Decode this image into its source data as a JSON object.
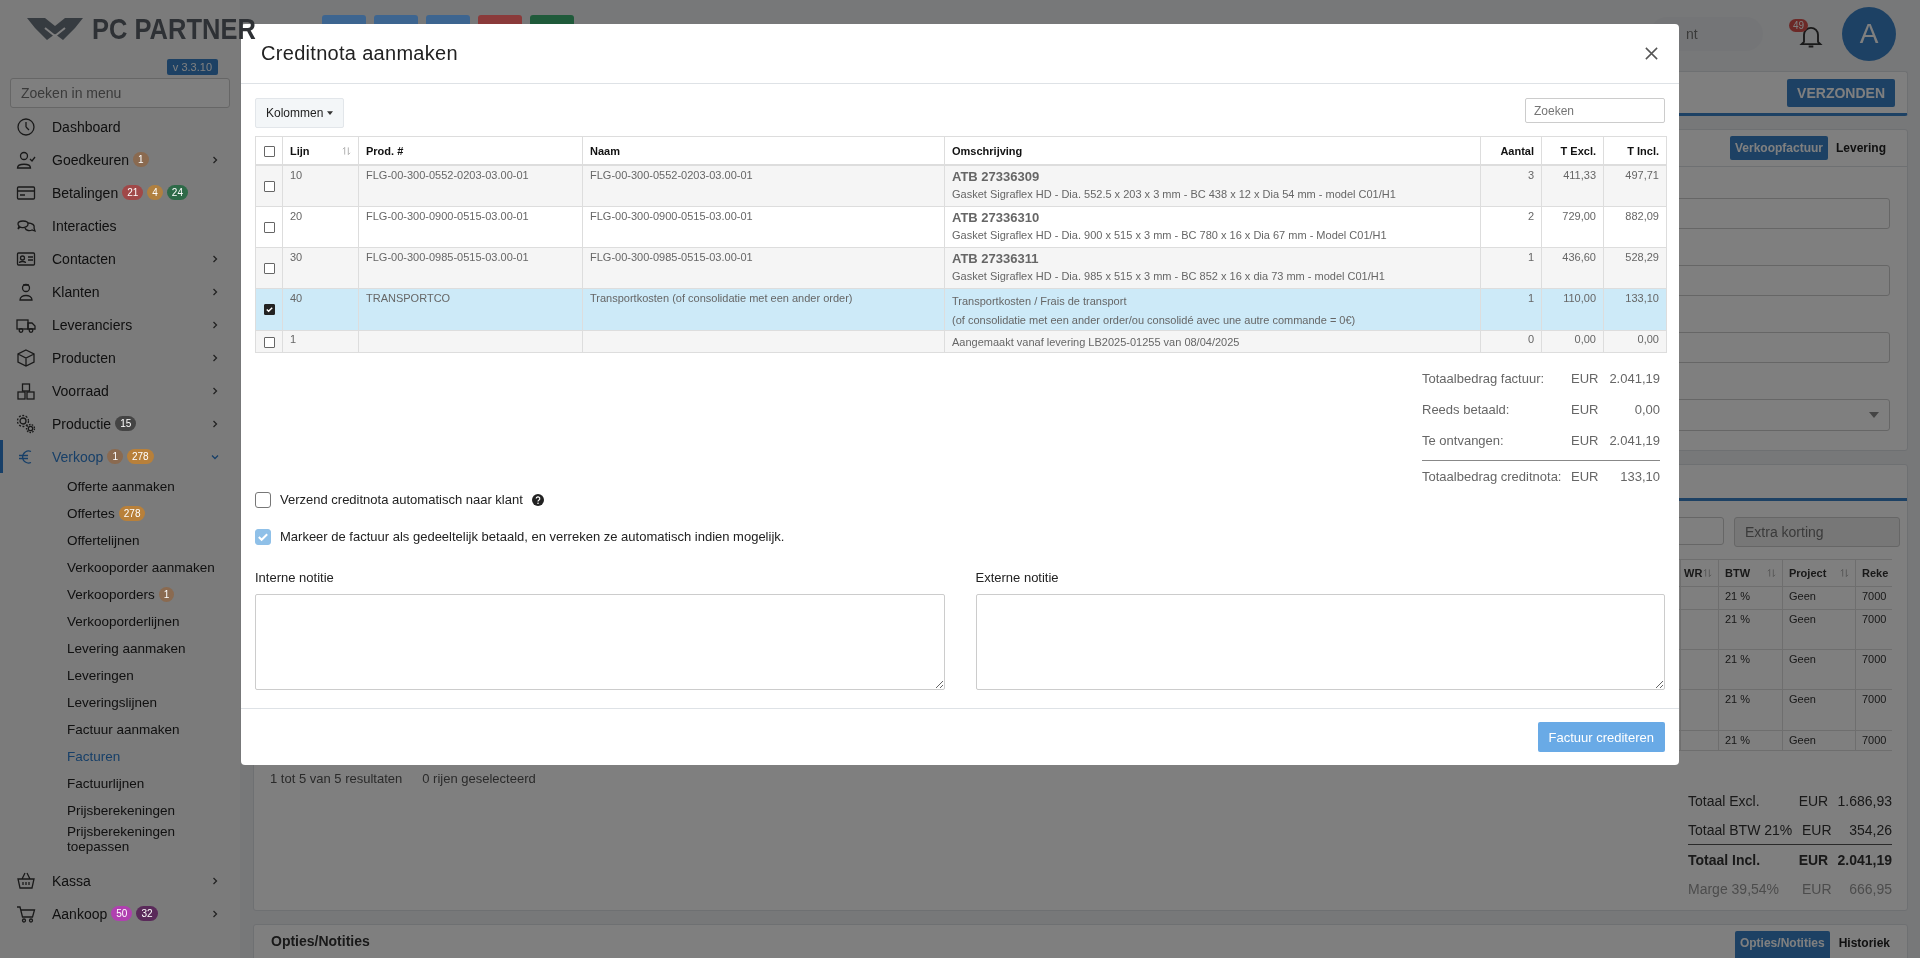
{
  "logo": {
    "text": "PC PARTNER",
    "version": "v 3.3.10"
  },
  "sidebar": {
    "search_placeholder": "Zoeken in menu",
    "items": [
      {
        "label": "Dashboard",
        "selected": false
      },
      {
        "label": "Goedkeuren",
        "selected": false,
        "expanded": false,
        "badges": [
          {
            "text": "1",
            "color": "#8a6a50"
          }
        ]
      },
      {
        "label": "Betalingen",
        "selected": false,
        "badges": [
          {
            "text": "21",
            "color": "#a04848"
          },
          {
            "text": "4",
            "color": "#b08040"
          },
          {
            "text": "24",
            "color": "#2e6a48"
          }
        ]
      },
      {
        "label": "Interacties",
        "selected": false
      },
      {
        "label": "Contacten",
        "selected": false,
        "expanded": false
      },
      {
        "label": "Klanten",
        "selected": false,
        "expanded": false
      },
      {
        "label": "Leveranciers",
        "selected": false,
        "expanded": false
      },
      {
        "label": "Producten",
        "selected": false,
        "expanded": false
      },
      {
        "label": "Voorraad",
        "selected": false,
        "expanded": false
      },
      {
        "label": "Productie",
        "selected": false,
        "expanded": false,
        "badges": [
          {
            "text": "15",
            "color": "#444444"
          }
        ]
      },
      {
        "label": "Verkoop",
        "selected": true,
        "expanded": true,
        "badges": [
          {
            "text": "1",
            "color": "#8a6a50"
          },
          {
            "text": "278",
            "color": "#b8803a"
          }
        ],
        "children": [
          {
            "label": "Offerte aanmaken",
            "selected": false
          },
          {
            "label": "Offertes",
            "selected": false,
            "badges": [
              {
                "text": "278",
                "color": "#b8803a"
              }
            ]
          },
          {
            "label": "Offertelijnen",
            "selected": false
          },
          {
            "label": "Verkooporder aanmaken",
            "selected": false
          },
          {
            "label": "Verkooporders",
            "selected": false,
            "badges": [
              {
                "text": "1",
                "color": "#8a6a50"
              }
            ]
          },
          {
            "label": "Verkooporderlijnen",
            "selected": false
          },
          {
            "label": "Levering aanmaken",
            "selected": false
          },
          {
            "label": "Leveringen",
            "selected": false
          },
          {
            "label": "Leveringslijnen",
            "selected": false
          },
          {
            "label": "Factuur aanmaken",
            "selected": false
          },
          {
            "label": "Facturen",
            "selected": true
          },
          {
            "label": "Factuurlijnen",
            "selected": false
          },
          {
            "label": "Prijsberekeningen",
            "selected": false
          },
          {
            "label": "Prijsberekeningen toepassen",
            "selected": false
          }
        ]
      },
      {
        "label": "Kassa",
        "selected": false,
        "expanded": false
      },
      {
        "label": "Aankoop",
        "selected": false,
        "expanded": false,
        "badges": [
          {
            "text": "50",
            "color": "#b040b0"
          },
          {
            "text": "32",
            "color": "#5a2a5a"
          }
        ]
      }
    ]
  },
  "topbar": {
    "toolbar": [
      {
        "color": "#3d6590"
      },
      {
        "color": "#3d6590"
      },
      {
        "color": "#3d6590"
      },
      {
        "color": "#8a3a3a"
      },
      {
        "color": "#1f5a3a"
      }
    ],
    "search_placeholder": "nt",
    "notifications": "49",
    "avatar": "A"
  },
  "status_card": {
    "button": "VERZONDEN"
  },
  "invoice_card": {
    "tabs": [
      {
        "label": "Verkoopfactuur",
        "selected": true
      },
      {
        "label": "Levering",
        "selected": false
      }
    ],
    "fields": [
      {
        "kind": "input"
      },
      {
        "kind": "input"
      },
      {
        "kind": "input"
      },
      {
        "kind": "select"
      }
    ]
  },
  "lines_card": {
    "filter_placeholder": "Extra korting",
    "table": {
      "columns": [
        {
          "label": "WR",
          "sortable": true
        },
        {
          "label": "BTW",
          "sortable": true
        },
        {
          "label": "Project",
          "sortable": true
        },
        {
          "label": "Reke",
          "sortable": false
        }
      ],
      "rows": [
        [
          "",
          "21 %",
          "Geen",
          "7000"
        ],
        [
          "",
          "21 %",
          "Geen",
          "7000"
        ],
        [
          "",
          "21 %",
          "Geen",
          "7000"
        ],
        [
          "",
          "21 %",
          "Geen",
          "7000"
        ],
        [
          "",
          "21 %",
          "Geen",
          "7000"
        ]
      ]
    },
    "results": "1 tot 5 van 5 resultaten",
    "selected_count": "0 rijen geselecteerd",
    "totals": [
      {
        "kind": "normal",
        "label": "Totaal Excl.",
        "currency": "EUR",
        "value": "1.686,93"
      },
      {
        "kind": "normal",
        "label": "Totaal BTW 21%",
        "currency": "EUR",
        "value": "354,26"
      },
      {
        "kind": "total",
        "label": "Totaal Incl.",
        "currency": "EUR",
        "value": "2.041,19"
      },
      {
        "kind": "muted",
        "label": "Marge 39,54%",
        "currency": "EUR",
        "value": "666,95"
      }
    ]
  },
  "options_card": {
    "title": "Opties/Notities",
    "tabs": [
      {
        "label": "Opties/Notities",
        "selected": true
      },
      {
        "label": "Historiek",
        "selected": false
      }
    ]
  },
  "modal": {
    "title": "Creditnota aanmaken",
    "columns_button": "Kolommen",
    "search_placeholder": "Zoeken",
    "table": {
      "all_selected": false,
      "columns": [
        {
          "label": "Lijn",
          "sortable": true,
          "kind": "text"
        },
        {
          "label": "Prod. #",
          "sortable": false,
          "kind": "text"
        },
        {
          "label": "Naam",
          "sortable": false,
          "kind": "text"
        },
        {
          "label": "Omschrijving",
          "sortable": false,
          "kind": "text"
        },
        {
          "label": "Aantal",
          "sortable": false,
          "kind": "number"
        },
        {
          "label": "T Excl.",
          "sortable": false,
          "kind": "number"
        },
        {
          "label": "T Incl.",
          "sortable": false,
          "kind": "number"
        }
      ],
      "rows": [
        {
          "checked": false,
          "line": "10",
          "product": "FLG-00-300-0552-0203-03.00-01",
          "name": "FLG-00-300-0552-0203-03.00-01",
          "code": "ATB 27336309",
          "description": [
            "Gasket Sigraflex HD - Dia. 552.5 x 203 x 3 mm - BC 438 x 12 x Dia 54 mm - model C01/H1"
          ],
          "quantity": "3",
          "excl": "411,33",
          "incl": "497,71"
        },
        {
          "checked": false,
          "line": "20",
          "product": "FLG-00-300-0900-0515-03.00-01",
          "name": "FLG-00-300-0900-0515-03.00-01",
          "code": "ATB 27336310",
          "description": [
            "Gasket Sigraflex HD - Dia. 900 x 515 x 3 mm - BC 780 x 16 x Dia 67 mm - Model C01/H1"
          ],
          "quantity": "2",
          "excl": "729,00",
          "incl": "882,09"
        },
        {
          "checked": false,
          "line": "30",
          "product": "FLG-00-300-0985-0515-03.00-01",
          "name": "FLG-00-300-0985-0515-03.00-01",
          "code": "ATB 27336311",
          "description": [
            "Gasket Sigraflex HD - Dia. 985 x 515 x 3 mm - BC 852 x 16 x dia 73 mm - model C01/H1"
          ],
          "quantity": "1",
          "excl": "436,60",
          "incl": "528,29"
        },
        {
          "checked": true,
          "line": "40",
          "product": "TRANSPORTCO",
          "name": "Transportkosten (of consolidatie met een ander order)",
          "description": [
            "Transportkosten / Frais de transport",
            "(of consolidatie met een ander order/ou consolidé avec une autre commande = 0€)"
          ],
          "quantity": "1",
          "excl": "110,00",
          "incl": "133,10"
        },
        {
          "checked": false,
          "line": "1",
          "description": [
            "Aangemaakt vanaf levering LB2025-01255 van 08/04/2025"
          ],
          "quantity": "0",
          "excl": "0,00",
          "incl": "0,00"
        }
      ]
    },
    "summary": [
      {
        "kind": "normal",
        "label": "Totaalbedrag factuur:",
        "currency": "EUR",
        "value": "2.041,19"
      },
      {
        "kind": "normal",
        "label": "Reeds betaald:",
        "currency": "EUR",
        "value": "0,00"
      },
      {
        "kind": "normal",
        "label": "Te ontvangen:",
        "currency": "EUR",
        "value": "2.041,19"
      },
      {
        "kind": "total",
        "label": "Totaalbedrag creditnota:",
        "currency": "EUR",
        "value": "133,10"
      }
    ],
    "options": [
      {
        "label": "Verzend creditnota automatisch naar klant",
        "checked": false,
        "disabled": false,
        "help": true
      },
      {
        "label": "Markeer de factuur als gedeeltelijk betaald, en verreken ze automatisch indien mogelijk.",
        "checked": true,
        "disabled": true,
        "help": false
      }
    ],
    "notes": [
      {
        "label": "Interne notitie"
      },
      {
        "label": "Externe notitie"
      }
    ],
    "submit": "Factuur crediteren"
  }
}
